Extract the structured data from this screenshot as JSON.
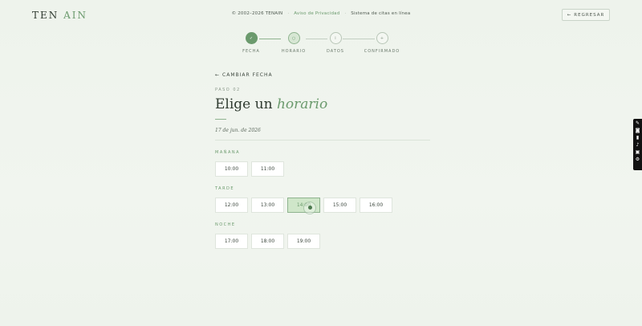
{
  "header": {
    "logo_part1": "TEN",
    "logo_part2": "AIN",
    "copyright": "© 2002–2026 TENAIN",
    "privacy_link": "Aviso de Privacidad",
    "system_text": "Sistema de citas en línea",
    "back_label": "REGRESAR"
  },
  "stepper": [
    {
      "label": "FECHA",
      "glyph": "✓",
      "state": "done"
    },
    {
      "label": "HORARIO",
      "glyph": "○",
      "state": "current"
    },
    {
      "label": "DATOS",
      "glyph": "i",
      "state": "pending"
    },
    {
      "label": "CONFIRMADO",
      "glyph": "+",
      "state": "pending"
    }
  ],
  "main": {
    "change_date": "CAMBIAR FECHA",
    "step_tag": "PASO 02",
    "title_plain": "Elige un",
    "title_em": "horario",
    "selected_date": "17 de jun. de 2026"
  },
  "periods": [
    {
      "label": "MAÑANA",
      "slots": [
        "10:00",
        "11:00"
      ]
    },
    {
      "label": "TARDE",
      "slots": [
        "12:00",
        "13:00",
        "14:00",
        "15:00",
        "16:00"
      ]
    },
    {
      "label": "NOCHE",
      "slots": [
        "17:00",
        "18:00",
        "19:00"
      ]
    }
  ],
  "selected_slot": "14:00",
  "colors": {
    "accent": "#6b9a6d",
    "background": "#eef3ec",
    "selected_slot_bg": "#cfe6c9"
  }
}
